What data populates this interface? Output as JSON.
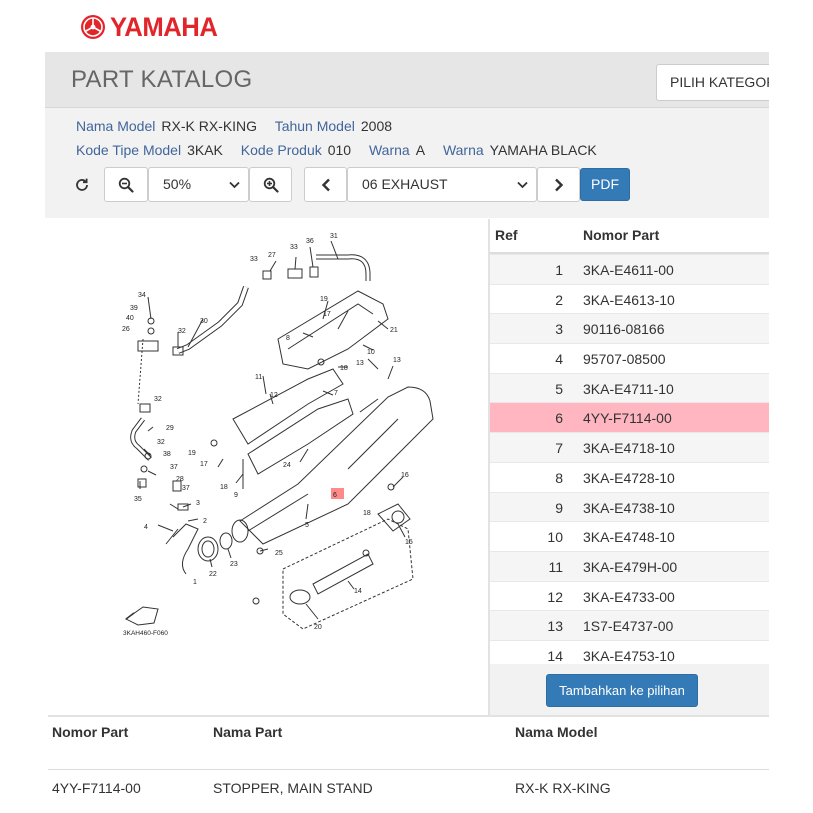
{
  "brand": {
    "name": "YAMAHA",
    "color": "#e1252b"
  },
  "header": {
    "title": "PART KATALOG",
    "category_placeholder": "PILIH KATEGORI"
  },
  "model_info": {
    "nama_model_label": "Nama Model",
    "nama_model_value": "RX-K RX-KING",
    "tahun_model_label": "Tahun Model",
    "tahun_model_value": "2008",
    "kode_tipe_label": "Kode Tipe Model",
    "kode_tipe_value": "3KAK",
    "kode_produk_label": "Kode Produk",
    "kode_produk_value": "010",
    "warna_code_label": "Warna",
    "warna_code_value": "A",
    "warna_name_label": "Warna",
    "warna_name_value": "YAMAHA BLACK"
  },
  "toolbar": {
    "refresh_icon": "refresh-icon",
    "zoom_out_icon": "zoom-out-icon",
    "zoom_value": "50%",
    "zoom_in_icon": "zoom-in-icon",
    "prev_icon": "chevron-left-icon",
    "section_value": "06 EXHAUST",
    "next_icon": "chevron-right-icon",
    "pdf_label": "PDF",
    "accent_color": "#337ab7"
  },
  "diagram": {
    "code": "3KAH460-F060",
    "highlight_ref": "6",
    "labels": [
      "1",
      "2",
      "3",
      "4",
      "5",
      "6",
      "7",
      "8",
      "9",
      "10",
      "11",
      "12",
      "13",
      "14",
      "15",
      "16",
      "17",
      "18",
      "19",
      "20",
      "21",
      "22",
      "23",
      "24",
      "25",
      "26",
      "27",
      "28",
      "29",
      "30",
      "31",
      "32",
      "33",
      "34",
      "35",
      "36",
      "37",
      "38",
      "39",
      "40"
    ]
  },
  "parts_table": {
    "headers": {
      "ref": "Ref",
      "nomor_part": "Nomor Part"
    },
    "selected_ref": "6",
    "highlight_color": "#ffb6c1",
    "rows": [
      {
        "ref": "1",
        "part": "3KA-E4611-00"
      },
      {
        "ref": "2",
        "part": "3KA-E4613-10"
      },
      {
        "ref": "3",
        "part": "90116-08166"
      },
      {
        "ref": "4",
        "part": "95707-08500"
      },
      {
        "ref": "5",
        "part": "3KA-E4711-10"
      },
      {
        "ref": "6",
        "part": "4YY-F7114-00"
      },
      {
        "ref": "7",
        "part": "3KA-E4718-10"
      },
      {
        "ref": "8",
        "part": "3KA-E4728-10"
      },
      {
        "ref": "9",
        "part": "3KA-E4738-10"
      },
      {
        "ref": "10",
        "part": "3KA-E4748-10"
      },
      {
        "ref": "11",
        "part": "3KA-E479H-00"
      },
      {
        "ref": "12",
        "part": "3KA-E4733-00"
      },
      {
        "ref": "13",
        "part": "1S7-E4737-00"
      },
      {
        "ref": "14",
        "part": "3KA-E4753-10"
      }
    ],
    "add_button_label": "Tambahkan ke pilihan"
  },
  "detail_table": {
    "headers": {
      "nomor_part": "Nomor Part",
      "nama_part": "Nama Part",
      "nama_model": "Nama Model"
    },
    "row": {
      "nomor_part": "4YY-F7114-00",
      "nama_part": "STOPPER, MAIN STAND",
      "nama_model": "RX-K RX-KING"
    }
  }
}
